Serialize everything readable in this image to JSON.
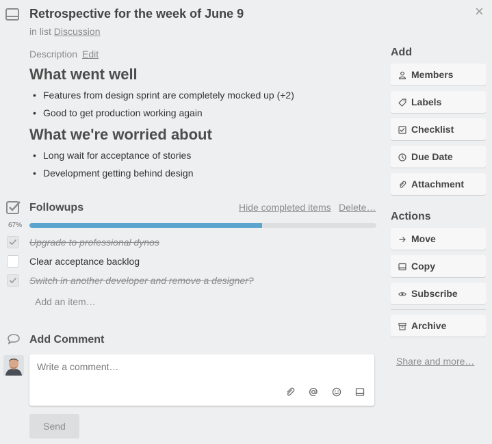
{
  "card": {
    "title": "Retrospective for the week of June 9",
    "in_list_prefix": "in list",
    "list_name": "Discussion",
    "close_symbol": "×"
  },
  "description": {
    "label": "Description",
    "edit_label": "Edit",
    "sections": [
      {
        "heading": "What went well",
        "items": [
          "Features from design sprint are completely mocked up (+2)",
          "Good to get production working again"
        ]
      },
      {
        "heading": "What we're worried about",
        "items": [
          "Long wait for acceptance of stories",
          "Development getting behind design"
        ]
      }
    ]
  },
  "checklist": {
    "title": "Followups",
    "hide_completed_label": "Hide completed items",
    "delete_label": "Delete…",
    "progress_text": "67%",
    "progress": 0.67,
    "progress_color": "#5ba4cf",
    "items": [
      {
        "text": "Upgrade to professional dynos",
        "done": true
      },
      {
        "text": "Clear acceptance backlog",
        "done": false
      },
      {
        "text": "Switch in another developer and remove a designer?",
        "done": true
      }
    ],
    "add_item_label": "Add an item…"
  },
  "comment": {
    "title": "Add Comment",
    "placeholder": "Write a comment…",
    "send_label": "Send",
    "icons": [
      "attachment-icon",
      "mention-icon",
      "emoji-icon",
      "card-icon"
    ]
  },
  "sidebar": {
    "add_heading": "Add",
    "add_buttons": [
      {
        "label": "Members",
        "icon": "person-icon"
      },
      {
        "label": "Labels",
        "icon": "tag-icon"
      },
      {
        "label": "Checklist",
        "icon": "checklist-icon"
      },
      {
        "label": "Due Date",
        "icon": "clock-icon"
      },
      {
        "label": "Attachment",
        "icon": "paperclip-icon"
      }
    ],
    "actions_heading": "Actions",
    "action_buttons": [
      {
        "label": "Move",
        "icon": "arrow-right-icon"
      },
      {
        "label": "Copy",
        "icon": "card-icon"
      },
      {
        "label": "Subscribe",
        "icon": "eye-icon"
      },
      {
        "label": "Archive",
        "icon": "archive-icon"
      }
    ],
    "share_label": "Share and more…"
  }
}
